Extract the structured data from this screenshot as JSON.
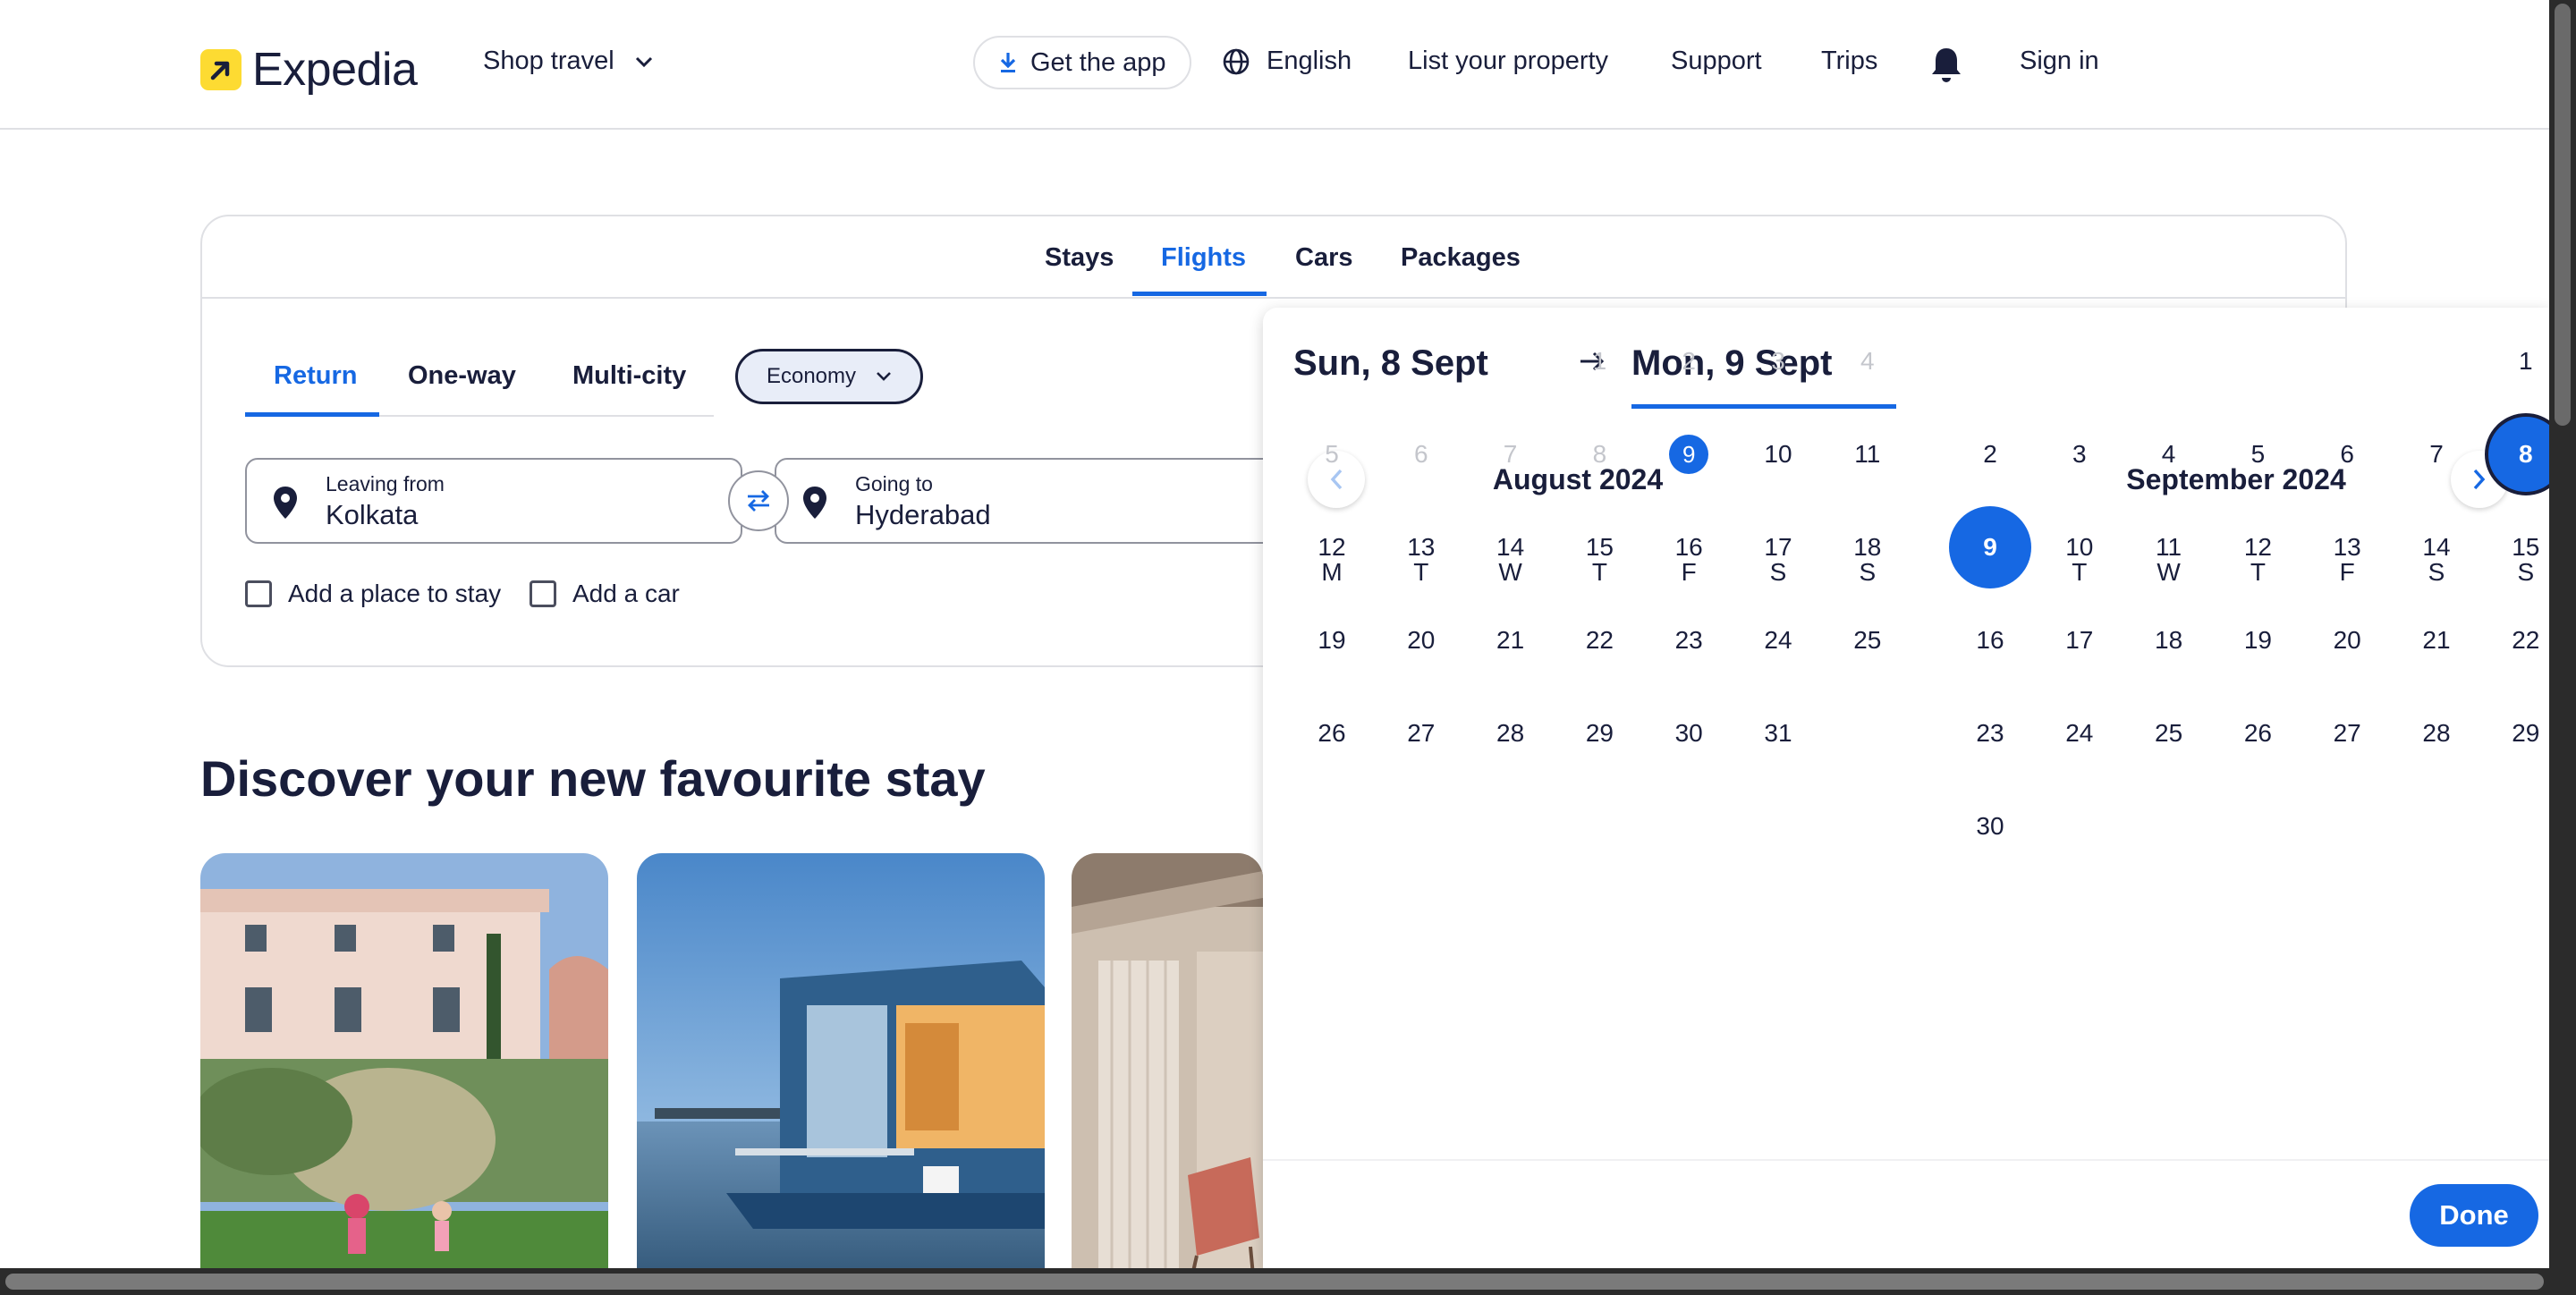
{
  "header": {
    "logo_text": "Expedia",
    "shop_travel": "Shop travel",
    "get_app": "Get the app",
    "language": "English",
    "list_property": "List your property",
    "support": "Support",
    "trips": "Trips",
    "sign_in": "Sign in"
  },
  "search": {
    "product_tabs": [
      "Stays",
      "Flights",
      "Cars",
      "Packages"
    ],
    "active_product": "Flights",
    "trip_types": [
      "Return",
      "One-way",
      "Multi-city"
    ],
    "active_trip_type": "Return",
    "cabin_class": "Economy",
    "leaving_label": "Leaving from",
    "leaving_value": "Kolkata",
    "going_label": "Going to",
    "going_value": "Hyderabad",
    "add_stay": "Add a place to stay",
    "add_car": "Add a car"
  },
  "discover": {
    "title": "Discover your new favourite stay"
  },
  "datepicker": {
    "start_date": "Sun, 8 Sept",
    "end_date": "Mon, 9 Sept",
    "weekdays": [
      "M",
      "T",
      "W",
      "T",
      "F",
      "S",
      "S"
    ],
    "months": [
      {
        "title": "August 2024",
        "first_weekday_index": 3,
        "days": 31,
        "disabled_through": 8,
        "today": 9
      },
      {
        "title": "September 2024",
        "first_weekday_index": 6,
        "days": 30,
        "selected_start": 8,
        "selected_end": 9
      }
    ],
    "done_label": "Done"
  },
  "colors": {
    "brand_yellow": "#fddb32",
    "accent_blue": "#1668e3",
    "text_dark": "#191e3b"
  }
}
